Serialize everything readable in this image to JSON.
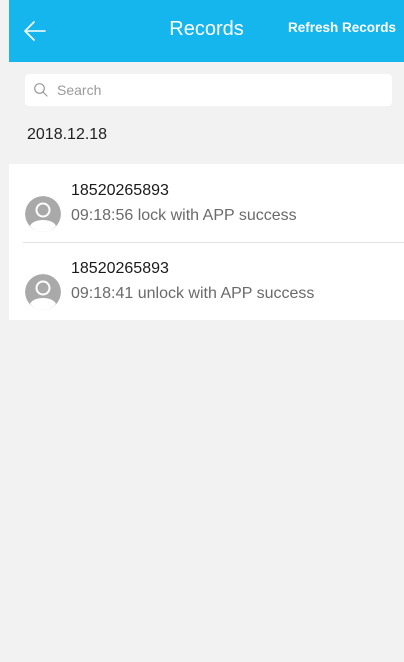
{
  "header": {
    "back_icon": "arrow-left-icon",
    "title": "Records",
    "refresh_label": "Refresh Records",
    "bar_color": "#15b6ee"
  },
  "search": {
    "icon": "search-icon",
    "placeholder": "Search",
    "value": ""
  },
  "date_group": "2018.12.18",
  "records": [
    {
      "avatar_icon": "user-avatar-icon",
      "phone": "18520265893",
      "description": "09:18:56 lock with APP success"
    },
    {
      "avatar_icon": "user-avatar-icon",
      "phone": "18520265893",
      "description": "09:18:41 unlock with APP success"
    }
  ]
}
